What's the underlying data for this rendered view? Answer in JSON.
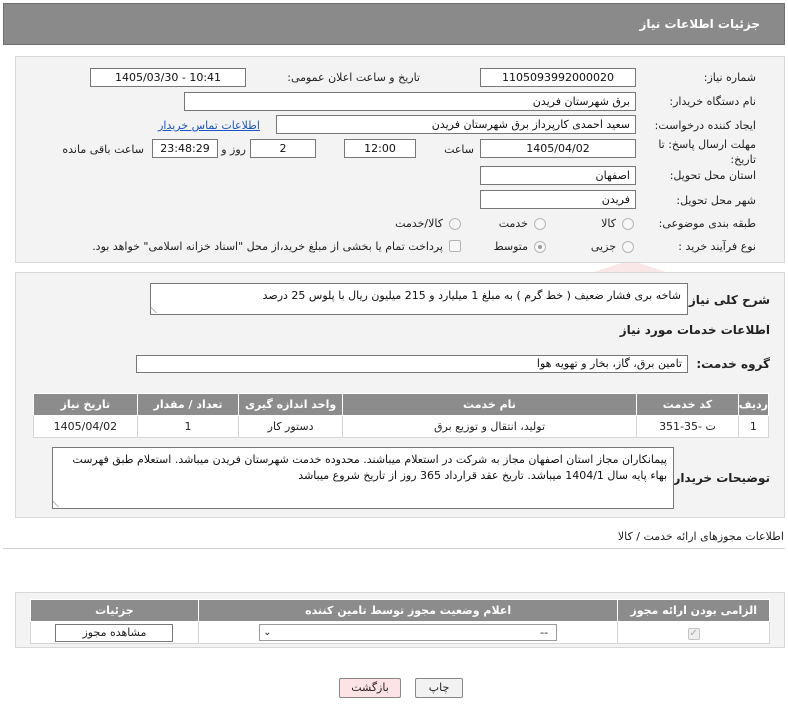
{
  "header": {
    "title": "جزئیات اطلاعات نیاز"
  },
  "form": {
    "need_number_label": "شماره نیاز:",
    "need_number": "1105093992000020",
    "announce_label": "تاریخ و ساعت اعلان عمومی:",
    "announce_value": "1405/03/30 - 10:41",
    "buyer_org_label": "نام دستگاه خریدار:",
    "buyer_org": "برق شهرستان فریدن",
    "creator_label": "ایجاد کننده درخواست:",
    "creator": "سعید احمدی کارپرداز برق شهرستان فریدن",
    "contact_link": "اطلاعات تماس خریدار",
    "deadline_label": "مهلت ارسال پاسخ: تا تاریخ:",
    "deadline_date": "1405/04/02",
    "time_label": "ساعت",
    "deadline_time": "12:00",
    "days_value": "2",
    "days_label": "روز و",
    "remaining_time": "23:48:29",
    "remaining_label": "ساعت باقی مانده",
    "province_label": "استان محل تحویل:",
    "province": "اصفهان",
    "city_label": "شهر محل تحویل:",
    "city": "فریدن",
    "category_label": "طبقه بندی موضوعی:",
    "category_options": [
      "کالا",
      "خدمت",
      "کالا/خدمت"
    ],
    "purchase_label": "نوع فرآیند خرید :",
    "purchase_options": [
      "جزیی",
      "متوسط"
    ],
    "payment_note": "پرداخت تمام یا بخشی از مبلغ خرید،از محل \"اسناد خزانه اسلامی\" خواهد بود."
  },
  "summary": {
    "label": "شرح کلی نیاز:",
    "text": "شاخه بری فشار ضعیف ( خط گرم ) به مبلغ 1 میلیارد و 215 میلیون ریال با پلوس 25 درصد"
  },
  "services": {
    "title": "اطلاعات خدمات مورد نیاز",
    "group_label": "گروه خدمت:",
    "group_value": "تامین برق، گاز، بخار و تهویه هوا",
    "columns": [
      "ردیف",
      "کد خدمت",
      "نام خدمت",
      "واحد اندازه گیری",
      "تعداد / مقدار",
      "تاریخ نیاز"
    ],
    "rows": [
      [
        "1",
        "ت -35-351",
        "تولید، انتقال و توزیع برق",
        "دستور کار",
        "1",
        "1405/04/02"
      ]
    ]
  },
  "buyer_notes": {
    "label": "توضیحات خریدار:",
    "text": "پیمانکاران مجاز استان اصفهان مجاز به شرکت در استعلام میباشند. محدوده خدمت شهرستان فریدن میباشد. استعلام طبق فهرست بهاء پایه سال 1404/1 میباشد. تاریخ عقد قرارداد 365 روز از تاریخ شروع میباشد"
  },
  "permits": {
    "title": "اطلاعات مجوزهای ارائه خدمت / کالا",
    "columns": [
      "الزامی بودن ارائه مجوز",
      "اعلام وضعیت مجوز توسط تامین کننده",
      "جزئیات"
    ],
    "select_value": "--",
    "view_button": "مشاهده مجوز"
  },
  "buttons": {
    "print": "چاپ",
    "back": "بازگشت"
  },
  "watermark": {
    "text": "AriaTender.net"
  },
  "colors": {
    "header_bg": "#8a8a8a",
    "link": "#1a56c4",
    "back_button_bg": "#fde3e3"
  }
}
